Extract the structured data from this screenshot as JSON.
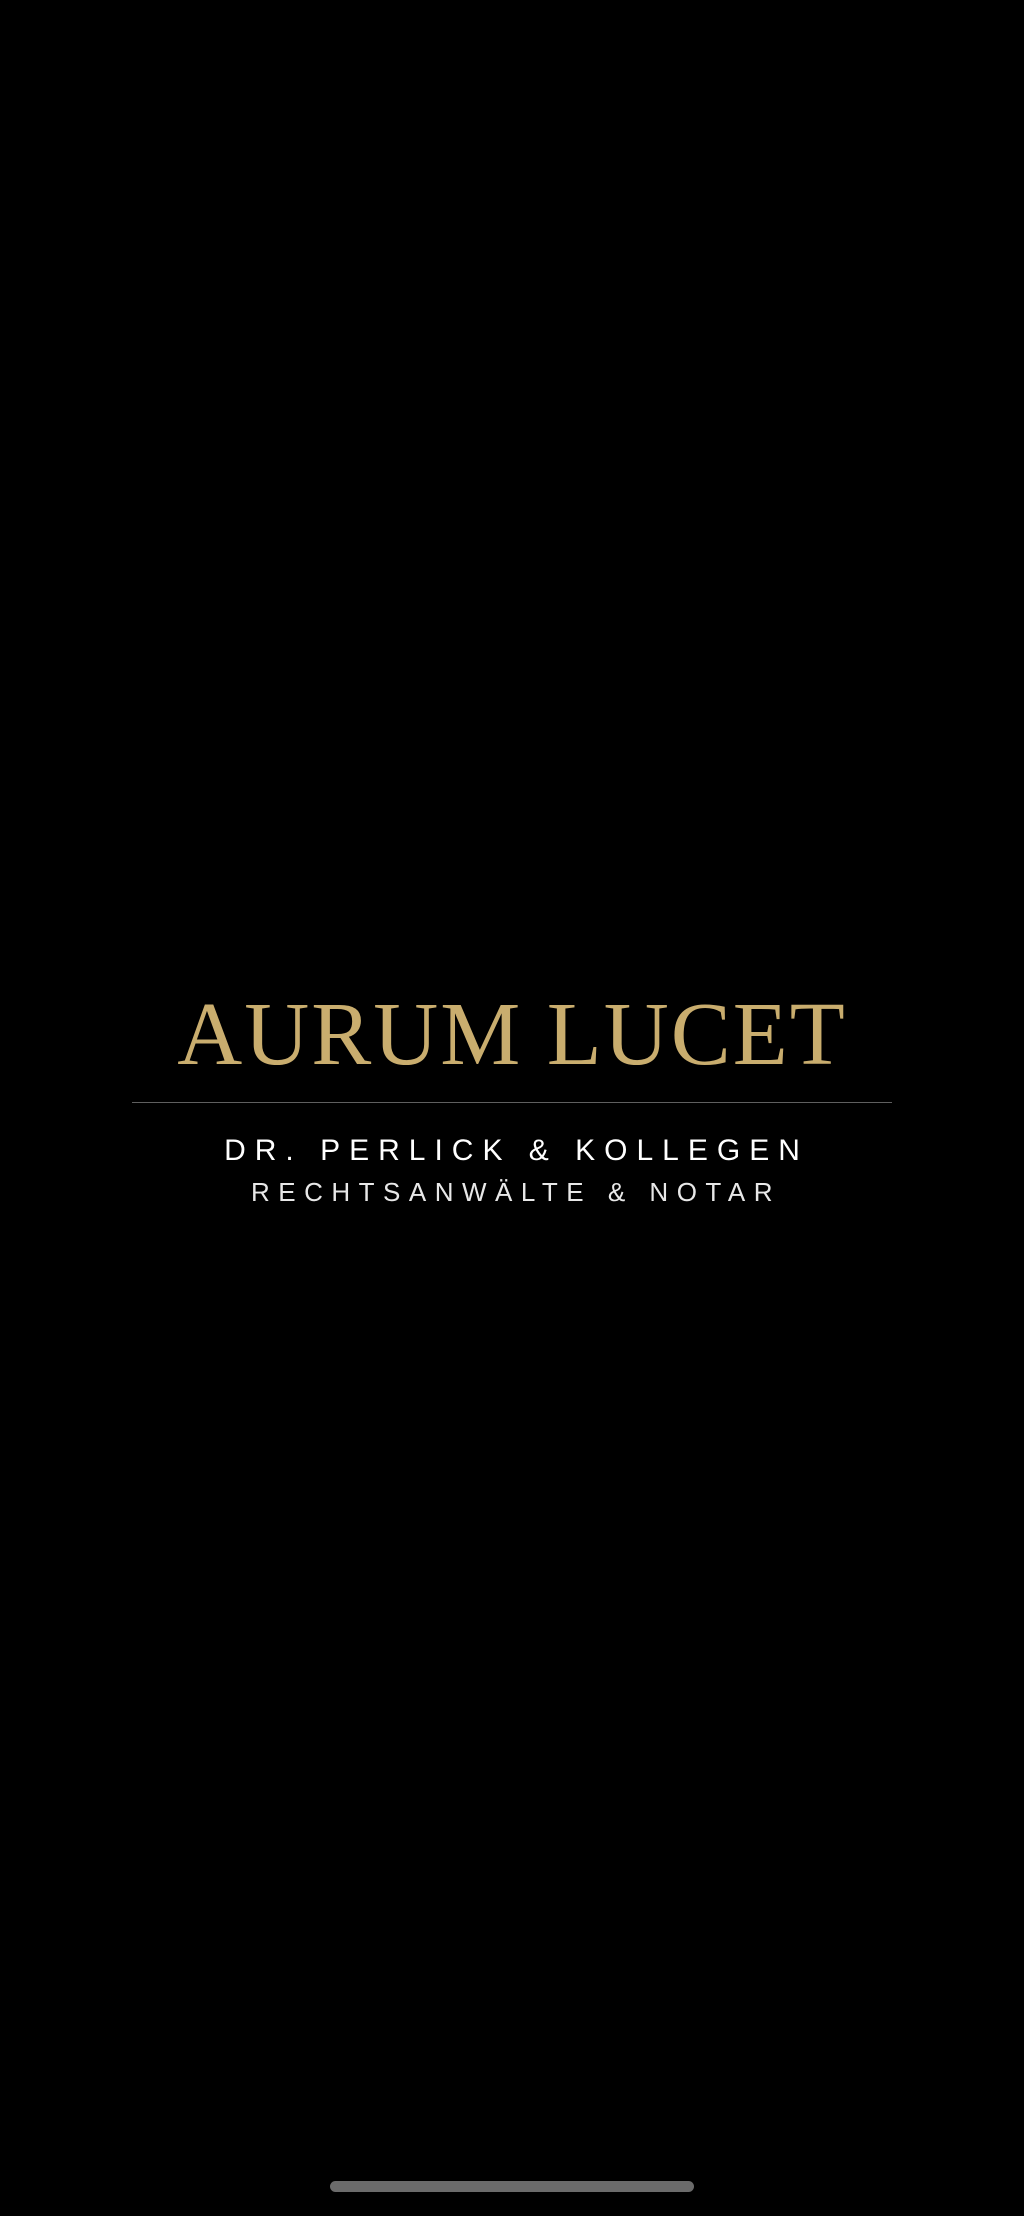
{
  "logo": {
    "title": "AURUM LUCET",
    "firm_name": "DR. PERLICK & KOLLEGEN",
    "subtitle": "RECHTSANWÄLTE & NOTAR"
  },
  "colors": {
    "background": "#000000",
    "gold_accent": "#c9ad6e",
    "divider": "#5f5f5f",
    "text": "#ffffff"
  },
  "system": {
    "home_indicator": "home-indicator"
  }
}
